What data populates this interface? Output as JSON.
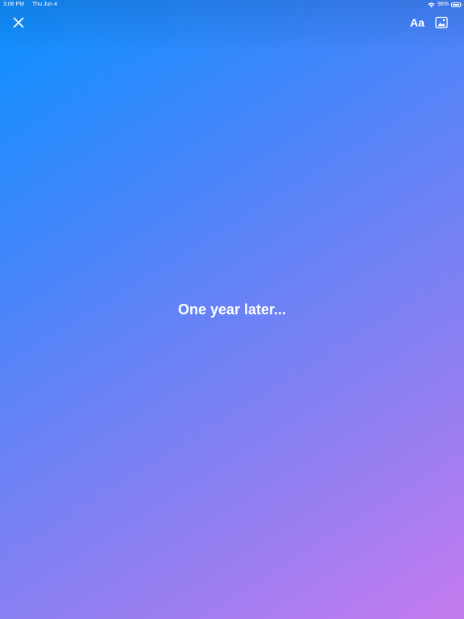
{
  "status_bar": {
    "time": "3:08 PM",
    "date": "Thu Jun 4",
    "battery_percent_label": "98%",
    "battery_level": 0.98,
    "wifi_icon": "wifi-icon",
    "battery_icon": "battery-icon"
  },
  "toolbar": {
    "close_icon": "close-icon",
    "text_style_label": "Aa",
    "image_icon": "image-icon"
  },
  "story": {
    "text": "One year later..."
  },
  "colors": {
    "gradient_start": "#0a92ff",
    "gradient_end": "#c57bef",
    "text": "#ffffff"
  }
}
